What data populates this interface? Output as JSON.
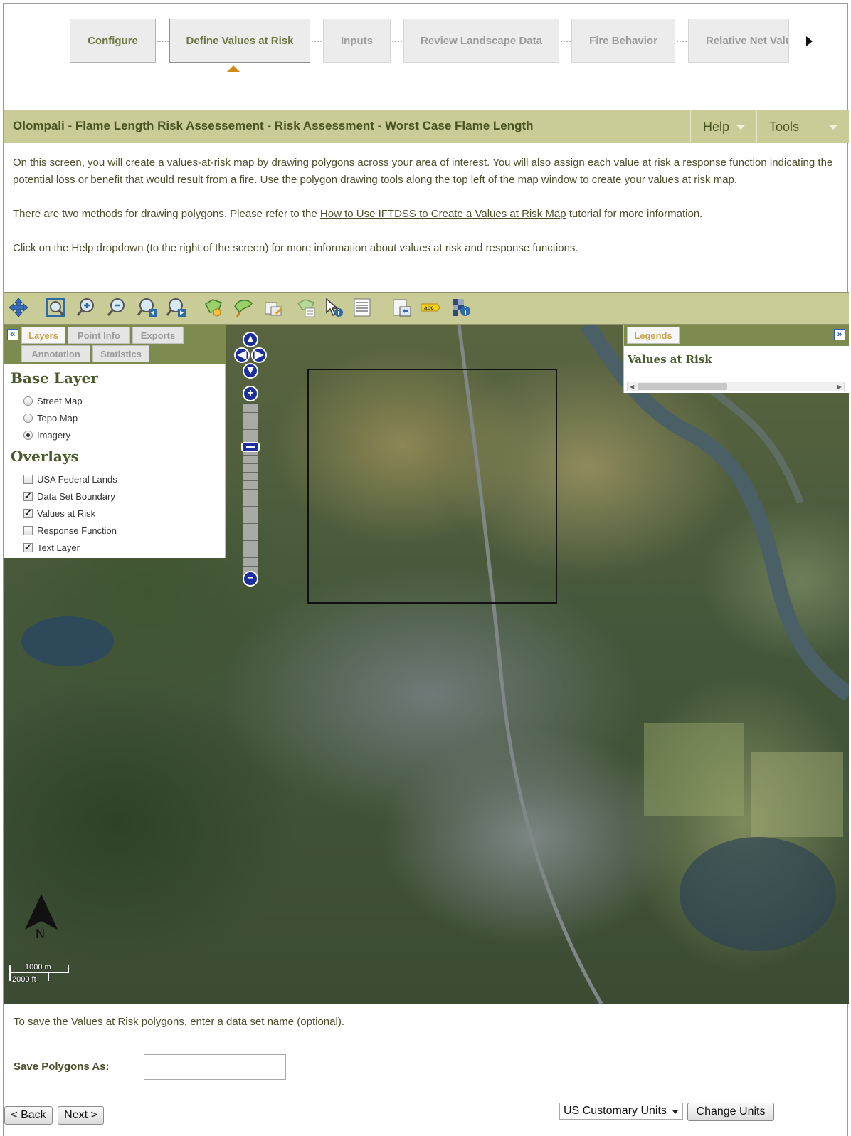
{
  "steps": {
    "items": [
      {
        "label": "Configure",
        "state": "done"
      },
      {
        "label": "Define Values at Risk",
        "state": "active"
      },
      {
        "label": "Inputs",
        "state": "todo"
      },
      {
        "label": "Review Landscape Data",
        "state": "todo"
      },
      {
        "label": "Fire Behavior",
        "state": "todo"
      },
      {
        "label": "Relative Net Valu",
        "state": "todo"
      }
    ],
    "next_icon": "triangle-right-icon"
  },
  "header": {
    "title": "Olompali - Flame Length Risk Assessement - Risk Assessment - Worst Case Flame Length",
    "help_label": "Help",
    "tools_label": "Tools"
  },
  "description": {
    "p1": "On this screen, you will create a values-at-risk map by drawing polygons across your area of interest. You will also assign each value at risk a response function indicating the potential loss or benefit that would result from a fire. Use the polygon drawing tools along the top left of the map window to create your values at risk map.",
    "p2_before": "There are two methods for drawing polygons. Please refer to the ",
    "p2_link": "How to Use IFTDSS to Create a Values at Risk Map",
    "p2_after": " tutorial for more information.",
    "p3": "Click on the Help dropdown (to the right of the screen) for more information about values at risk and response functions."
  },
  "toolbar": {
    "tools": [
      "pan-icon",
      "zoom-extent-icon",
      "zoom-in-icon",
      "zoom-out-icon",
      "zoom-previous-icon",
      "zoom-next-icon",
      "draw-polygon-icon",
      "draw-freehand-polygon-icon",
      "edit-polygon-icon",
      "polygon-attributes-icon",
      "identify-icon",
      "attribute-table-icon",
      "export-map-icon",
      "label-text-icon",
      "map-info-icon"
    ]
  },
  "layer_panel": {
    "tabs": [
      "Layers",
      "Point Info",
      "Exports",
      "Annotation",
      "Statistics"
    ],
    "active_tab": "Layers",
    "base_layer_heading": "Base Layer",
    "base_layers": [
      {
        "label": "Street Map",
        "selected": false
      },
      {
        "label": "Topo Map",
        "selected": false
      },
      {
        "label": "Imagery",
        "selected": true
      }
    ],
    "overlays_heading": "Overlays",
    "overlays": [
      {
        "label": "USA Federal Lands",
        "checked": false
      },
      {
        "label": "Data Set Boundary",
        "checked": true
      },
      {
        "label": "Values at Risk",
        "checked": true
      },
      {
        "label": "Response Function",
        "checked": false
      },
      {
        "label": "Text Layer",
        "checked": true
      }
    ],
    "collapse_label": "«"
  },
  "legend_panel": {
    "tab": "Legends",
    "title": "Values at Risk",
    "expand_label": "»"
  },
  "map": {
    "north_label": "N",
    "scale_metric": "1000 m",
    "scale_imperial": "2000 ft"
  },
  "form": {
    "save_note": "To save the Values at Risk polygons, enter a data set name (optional).",
    "save_label": "Save Polygons As:",
    "save_value": "",
    "back_label": "< Back",
    "next_label": "Next >",
    "units_selected": "US Customary Units",
    "change_units_label": "Change Units"
  }
}
